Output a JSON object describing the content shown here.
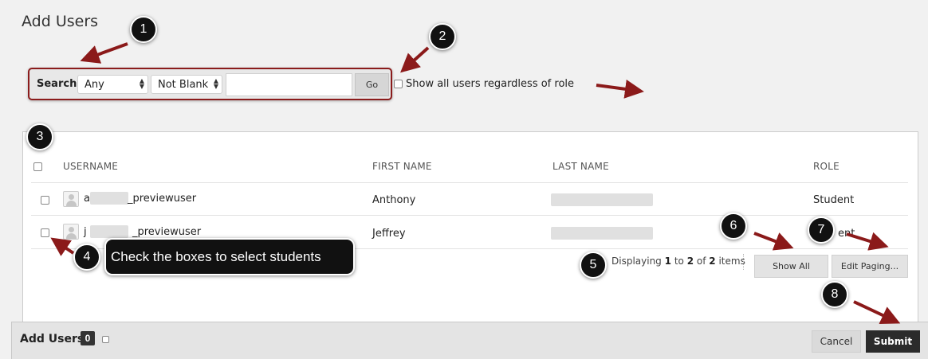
{
  "page": {
    "title": "Add Users"
  },
  "search": {
    "label": "Search:",
    "field_select": "Any",
    "operator_select": "Not Blank",
    "input_value": "",
    "go_label": "Go",
    "show_all_users_label": "Show all users regardless of role"
  },
  "table": {
    "columns": [
      "USERNAME",
      "FIRST NAME",
      "LAST NAME",
      "ROLE"
    ],
    "rows": [
      {
        "username_prefix": "a",
        "username_suffix": "_previewuser",
        "first_name": "Anthony",
        "role": "Student"
      },
      {
        "username_prefix": "j",
        "username_suffix": "_previewuser",
        "first_name": "Jeffrey",
        "role": "ent"
      }
    ]
  },
  "paging": {
    "displaying_prefix": "Displaying",
    "from": "1",
    "to_word": "to",
    "to": "2",
    "of_word": "of",
    "total": "2",
    "items_word": "items",
    "show_all_label": "Show All",
    "edit_paging_label": "Edit Paging..."
  },
  "bottom_bar": {
    "title": "Add Users",
    "count": "0",
    "cancel_label": "Cancel",
    "submit_label": "Submit"
  },
  "annotations": {
    "callouts": [
      "1",
      "2",
      "3",
      "4",
      "5",
      "6",
      "7",
      "8"
    ],
    "tooltip_text": "Check the boxes to select students",
    "arrow_color": "#8b1a1a"
  }
}
